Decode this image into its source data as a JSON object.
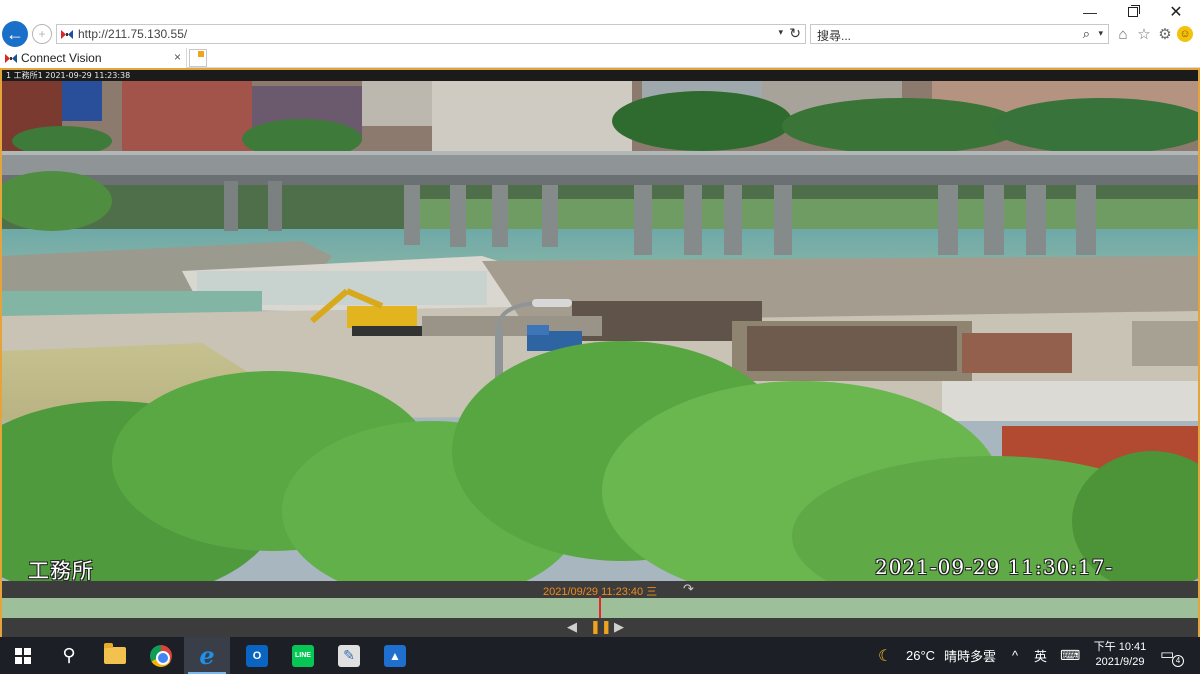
{
  "window": {
    "minimize_glyph": "—",
    "close_glyph": "✕"
  },
  "navbar": {
    "back_glyph": "←",
    "forward_glyph": "+",
    "url": "http://211.75.130.55/",
    "address_dropdown_glyph": "▾",
    "refresh_glyph": "↻",
    "search_placeholder": "搜尋...",
    "search_glyph": "⌕",
    "search_dropdown_glyph": "▾",
    "tools": {
      "home_glyph": "⌂",
      "favorites_glyph": "☆",
      "settings_glyph": "⚙",
      "feedback_glyph": "☺"
    }
  },
  "tab": {
    "title": "Connect Vision",
    "close_glyph": "×"
  },
  "viewer": {
    "camera_label": "1 工務所1  2021-09-29 11:23:38",
    "osd_location": "工務所",
    "osd_timestamp": "2021-09-29 11:30:17-",
    "timeline_timestamp": "2021/09/29 11:23:40 三",
    "timeline_back_glyph": "↷",
    "playhead_fraction": 0.5,
    "controls": {
      "prev_glyph": "◀",
      "pause_glyph": "❚❚",
      "next_glyph": "▶"
    }
  },
  "taskbar": {
    "apps": [
      {
        "name": "start",
        "active": false
      },
      {
        "name": "search",
        "glyph": "⚲"
      },
      {
        "name": "file-explorer"
      },
      {
        "name": "chrome"
      },
      {
        "name": "internet-explorer",
        "glyph": "e",
        "active": true
      },
      {
        "name": "outlook",
        "glyph": "O",
        "color": "#0a64c2"
      },
      {
        "name": "line",
        "glyph": "LINE",
        "color": "#06c755"
      },
      {
        "name": "paint",
        "glyph": "✎",
        "color": "#e0e0e0"
      },
      {
        "name": "photos",
        "glyph": "▲",
        "color": "#1f6fcf"
      }
    ],
    "weather_glyph": "☾",
    "temperature": "26°C",
    "weather_desc": "晴時多雲",
    "tray_up_glyph": "^",
    "ime_label": "英",
    "keyboard_glyph": "⌨",
    "time": "下午 10:41",
    "date": "2021/9/29",
    "notification_glyph": "▭",
    "notification_count": "4"
  },
  "colors": {
    "viewer_border": "#e4a43a",
    "timeline_text": "#f08a1a",
    "timeline_bar": "#9dbf9a",
    "playhead": "#e8262a",
    "ie_blue": "#1a6fc8"
  }
}
